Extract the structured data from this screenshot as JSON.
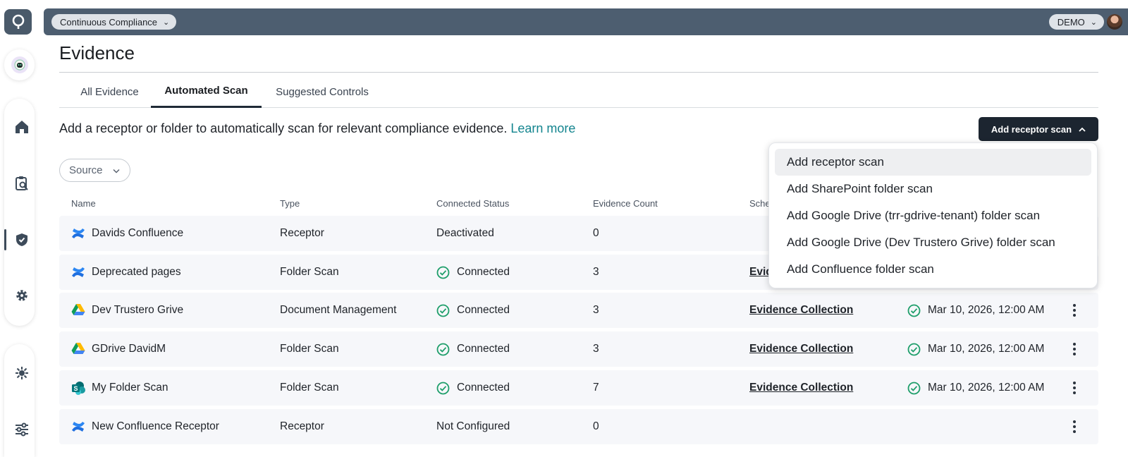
{
  "header": {
    "workspace_label": "Continuous Compliance",
    "org_label": "DEMO"
  },
  "page": {
    "title": "Evidence",
    "tabs": [
      {
        "label": "All Evidence"
      },
      {
        "label": "Automated Scan"
      },
      {
        "label": "Suggested Controls"
      }
    ],
    "intro_text": "Add a receptor or folder to automatically scan for relevant compliance evidence. ",
    "learn_more": "Learn more",
    "add_button_label": "Add receptor scan",
    "source_filter_label": "Source"
  },
  "table": {
    "columns": [
      "Name",
      "Type",
      "Connected Status",
      "Evidence Count",
      "Sche"
    ],
    "rows": [
      {
        "name": "Davids Confluence",
        "type": "Receptor",
        "status": "Deactivated",
        "count": "0",
        "schedule": "",
        "last_scan": "",
        "icon": "confluence-icon"
      },
      {
        "name": "Deprecated pages",
        "type": "Folder Scan",
        "status": "Connected",
        "count": "3",
        "schedule": "Evide",
        "last_scan": "",
        "icon": "confluence-icon"
      },
      {
        "name": "Dev Trustero Grive",
        "type": "Document Management",
        "status": "Connected",
        "count": "3",
        "schedule": "Evidence Collection",
        "last_scan": "Mar 10, 2026, 12:00 AM",
        "icon": "google-drive-icon"
      },
      {
        "name": "GDrive DavidM",
        "type": "Folder Scan",
        "status": "Connected",
        "count": "3",
        "schedule": "Evidence Collection",
        "last_scan": "Mar 10, 2026, 12:00 AM",
        "icon": "google-drive-icon"
      },
      {
        "name": "My Folder Scan",
        "type": "Folder Scan",
        "status": "Connected",
        "count": "7",
        "schedule": "Evidence Collection",
        "last_scan": "Mar 10, 2026, 12:00 AM",
        "icon": "sharepoint-icon"
      },
      {
        "name": "New Confluence Receptor",
        "type": "Receptor",
        "status": "Not Configured",
        "count": "0",
        "schedule": "",
        "last_scan": "",
        "icon": "confluence-icon"
      }
    ]
  },
  "dropdown": {
    "items": [
      {
        "label": "Add receptor scan"
      },
      {
        "label": "Add SharePoint folder scan"
      },
      {
        "label": "Add Google Drive (trr-gdrive-tenant) folder scan"
      },
      {
        "label": "Add Google Drive (Dev Trustero Grive) folder scan"
      },
      {
        "label": "Add Confluence folder scan"
      }
    ]
  },
  "colors": {
    "accent": "#14858f",
    "topbar": "#4d5e70",
    "primary_button": "#1c2530",
    "success": "#1e9e6a"
  }
}
